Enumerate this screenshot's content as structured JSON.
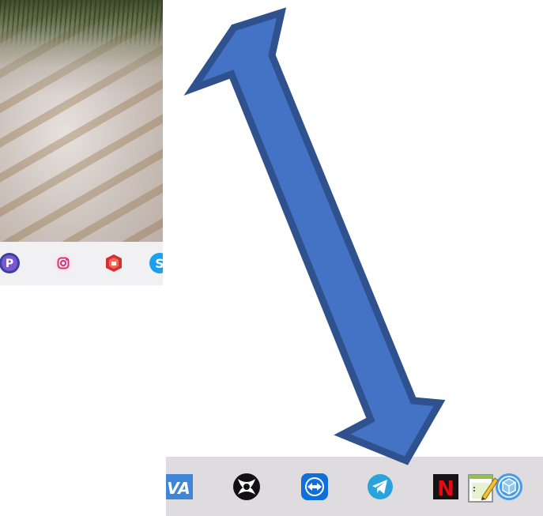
{
  "photo_crop": {
    "taskbar_icons": [
      {
        "name": "picsart-icon",
        "letter": "P",
        "color": "#5b4fc4"
      },
      {
        "name": "instagram-icon",
        "color": "#e1306c"
      },
      {
        "name": "sketchup-icon",
        "color": "#d62f2f"
      },
      {
        "name": "skype-icon",
        "letter": "S",
        "color": "#1aa0f0"
      }
    ]
  },
  "taskbar": {
    "icons": [
      {
        "name": "app-va-icon",
        "text": "VA",
        "color": "#3f86d8"
      },
      {
        "name": "xbox-icon",
        "color": "#111111"
      },
      {
        "name": "teamviewer-icon",
        "color": "#0e6fd8"
      },
      {
        "name": "telegram-icon",
        "color": "#2aa3dd"
      },
      {
        "name": "netflix-icon",
        "letter": "N",
        "color": "#e50914"
      },
      {
        "name": "3d-viewer-icon",
        "color": "#4a9be6",
        "highlighted": true
      },
      {
        "name": "notepad-icon",
        "color": "#7ab648"
      }
    ]
  },
  "annotation": {
    "arrow_fill": "#4472c4",
    "arrow_stroke": "#2f528f",
    "points_to": "3d-viewer-icon"
  }
}
